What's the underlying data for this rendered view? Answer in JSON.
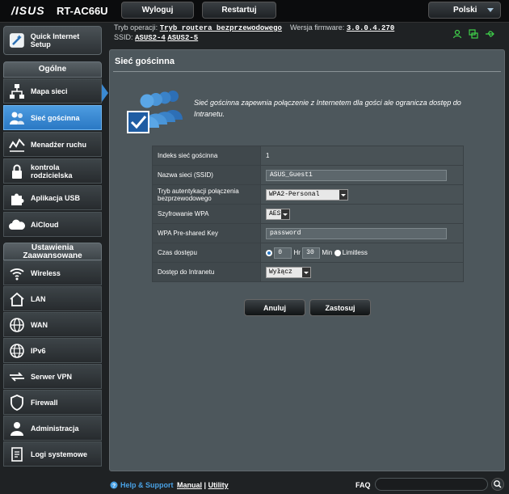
{
  "header": {
    "logo": "/ISUS",
    "model": "RT-AC66U",
    "logout_label": "Wyloguj",
    "restart_label": "Restartuj",
    "language": "Polski"
  },
  "info": {
    "mode_label": "Tryb operacji:",
    "mode_value": "Tryb routera bezprzewodowego",
    "firmware_label": "Wersja firmware:",
    "firmware_value": "3.0.0.4.270",
    "ssid_label": "SSID:",
    "ssid_1": "ASUS2-4",
    "ssid_2": "ASUS2-5"
  },
  "sidebar": {
    "qis_label": "Quick Internet Setup",
    "general_header": "Ogólne",
    "general_items": [
      {
        "label": "Mapa sieci"
      },
      {
        "label": "Sieć gościnna"
      },
      {
        "label": "Menadżer ruchu"
      },
      {
        "label": "kontrola rodzicielska"
      },
      {
        "label": "Aplikacja USB"
      },
      {
        "label": "AiCloud"
      }
    ],
    "advanced_header": "Ustawienia Zaawansowane",
    "advanced_items": [
      {
        "label": "Wireless"
      },
      {
        "label": "LAN"
      },
      {
        "label": "WAN"
      },
      {
        "label": "IPv6"
      },
      {
        "label": "Serwer VPN"
      },
      {
        "label": "Firewall"
      },
      {
        "label": "Administracja"
      },
      {
        "label": "Logi systemowe"
      }
    ]
  },
  "main": {
    "title": "Sieć gościnna",
    "description": "Sieć gościnna zapewnia połączenie z Internetem dla gości ale ogranicza dostęp do Intranetu.",
    "form": {
      "index_label": "Indeks sieć gościnna",
      "index_value": "1",
      "ssid_label": "Nazwa sieci (SSID)",
      "ssid_value": "ASUS_Guest1",
      "auth_label": "Tryb autentykacji połączenia bezprzewodowego",
      "auth_value": "WPA2-Personal",
      "enc_label": "Szyfrowanie WPA",
      "enc_value": "AES",
      "psk_label": "WPA Pre-shared Key",
      "psk_value": "password",
      "time_label": "Czas dostępu",
      "time_hr_value": "0",
      "time_hr_unit": "Hr",
      "time_min_value": "30",
      "time_min_unit": "Min",
      "time_limitless": "Limitless",
      "intranet_label": "Dostęp do Intranetu",
      "intranet_value": "Wyłącz"
    },
    "cancel_label": "Anuluj",
    "apply_label": "Zastosuj"
  },
  "footer": {
    "help": "Help & Support",
    "manual": "Manual",
    "separator": "|",
    "utility": "Utility",
    "faq": "FAQ"
  }
}
